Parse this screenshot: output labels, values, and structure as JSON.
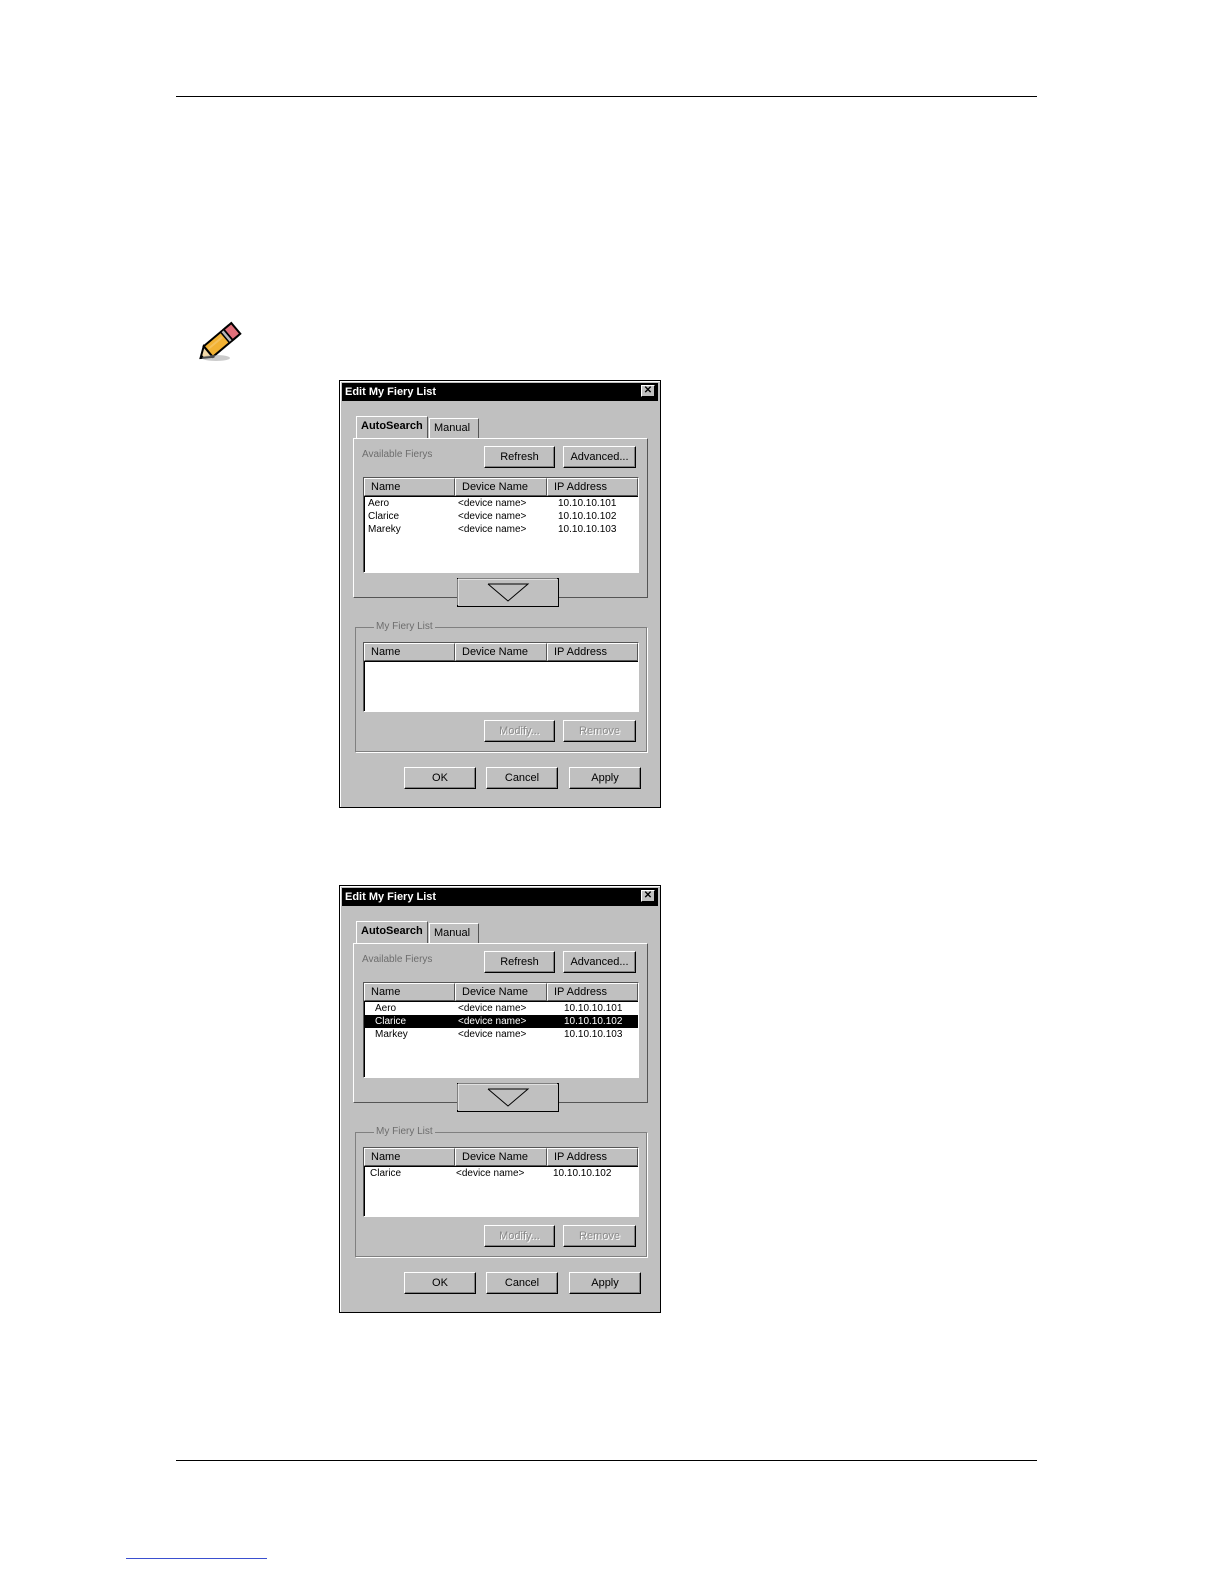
{
  "dialogs": [
    {
      "title": "Edit My Fiery List",
      "close_glyph": "✕",
      "tabs": {
        "active": "AutoSearch",
        "inactive": "Manual"
      },
      "available_label": "Available Fierys",
      "refresh_label": "Refresh",
      "advanced_label": "Advanced...",
      "columns": {
        "name": "Name",
        "device": "Device Name",
        "ip": "IP Address"
      },
      "available_rows": [
        {
          "name": "Aero",
          "device": "<device name>",
          "ip": "10.10.10.101"
        },
        {
          "name": "Clarice",
          "device": "<device name>",
          "ip": "10.10.10.102"
        },
        {
          "name": "Mareky",
          "device": "<device name>",
          "ip": "10.10.10.103"
        }
      ],
      "my_list_title": "My Fiery List",
      "my_list_rows": [],
      "modify_label": "Modify...",
      "remove_label": "Remove",
      "ok_label": "OK",
      "cancel_label": "Cancel",
      "apply_label": "Apply"
    },
    {
      "title": "Edit My Fiery List",
      "close_glyph": "✕",
      "tabs": {
        "active": "AutoSearch",
        "inactive": "Manual"
      },
      "available_label": "Available Fierys",
      "refresh_label": "Refresh",
      "advanced_label": "Advanced...",
      "columns": {
        "name": "Name",
        "device": "Device Name",
        "ip": "IP Address"
      },
      "available_rows": [
        {
          "name": "Aero",
          "device": "<device name>",
          "ip": "10.10.10.101"
        },
        {
          "name": "Clarice",
          "device": "<device name>",
          "ip": "10.10.10.102"
        },
        {
          "name": "Markey",
          "device": "<device name>",
          "ip": "10.10.10.103"
        }
      ],
      "selected_row": 1,
      "my_list_title": "My Fiery List",
      "my_list_rows": [
        {
          "name": "Clarice",
          "device": "<device name>",
          "ip": "10.10.10.102"
        }
      ],
      "modify_label": "Modify...",
      "remove_label": "Remove",
      "ok_label": "OK",
      "cancel_label": "Cancel",
      "apply_label": "Apply"
    }
  ],
  "note_icon": "pencil-icon",
  "colors": {
    "dialog_face": "#c0c0c0",
    "titlebar": "#000000",
    "selection": "#000000"
  }
}
